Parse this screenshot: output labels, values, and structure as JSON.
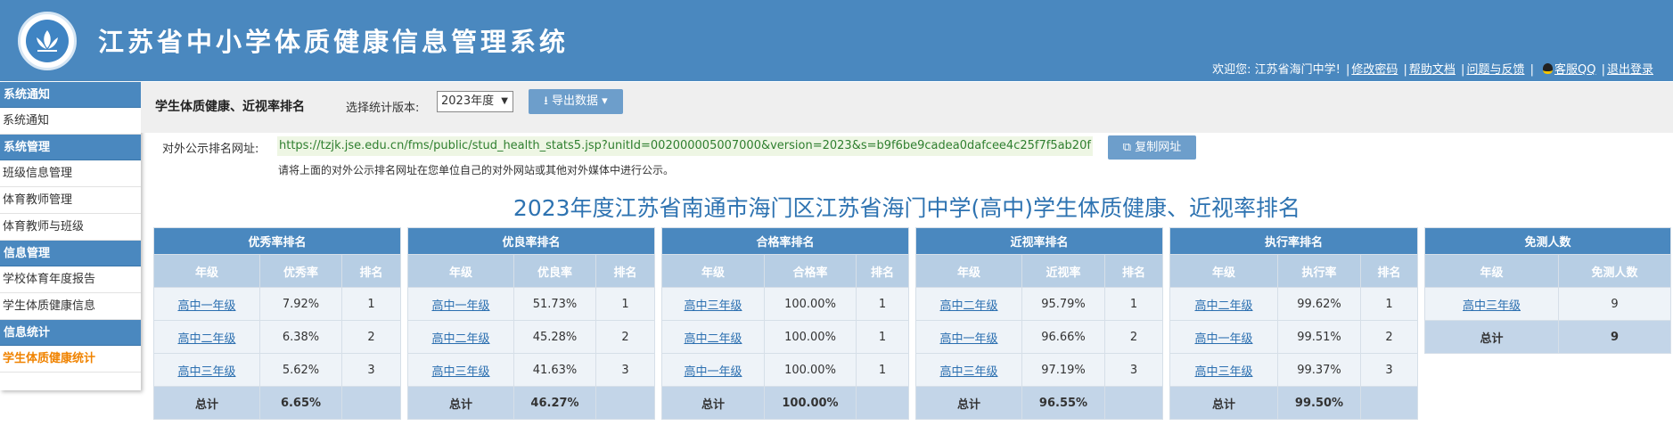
{
  "header": {
    "site_title": "江苏省中小学体质健康信息管理系统",
    "welcome": "欢迎您: 江苏省海门中学!",
    "links": [
      "修改密码",
      "帮助文档",
      "问题与反馈"
    ],
    "qq_label": "客服QQ",
    "logout": "退出登录"
  },
  "sidebar": {
    "groups": [
      {
        "title": "系统通知",
        "items": [
          "系统通知"
        ]
      },
      {
        "title": "系统管理",
        "items": [
          "班级信息管理",
          "体育教师管理",
          "体育教师与班级"
        ]
      },
      {
        "title": "信息管理",
        "items": [
          "学校体育年度报告",
          "学生体质健康信息"
        ]
      },
      {
        "title": "信息统计",
        "items": [
          "学生体质健康统计"
        ]
      }
    ],
    "active_item": "学生体质健康统计"
  },
  "toolbar": {
    "title": "学生体质健康、近视率排名",
    "version_label": "选择统计版本:",
    "version_value": "2023年度",
    "export_label": "导出数据"
  },
  "public_url": {
    "label": "对外公示排名网址:",
    "url": "https://tzjk.jse.edu.cn/fms/public/stud_health_stats5.jsp?unitId=002000005007000&version=2023&s=b9f6be9cadea0dafcee4c25f7f5ab20f",
    "copy_label": "复制网址",
    "note": "请将上面的对外公示排名网址在您单位自己的对外网站或其他对外媒体中进行公示。"
  },
  "report_title": "2023年度江苏省南通市海门区江苏省海门中学(高中)学生体质健康、近视率排名",
  "tables": [
    {
      "caption": "优秀率排名",
      "columns": [
        "年级",
        "优秀率",
        "排名"
      ],
      "rows": [
        [
          "高中一年级",
          "7.92%",
          "1"
        ],
        [
          "高中二年级",
          "6.38%",
          "2"
        ],
        [
          "高中三年级",
          "5.62%",
          "3"
        ]
      ],
      "total": [
        "总计",
        "6.65%",
        ""
      ]
    },
    {
      "caption": "优良率排名",
      "columns": [
        "年级",
        "优良率",
        "排名"
      ],
      "rows": [
        [
          "高中一年级",
          "51.73%",
          "1"
        ],
        [
          "高中二年级",
          "45.28%",
          "2"
        ],
        [
          "高中三年级",
          "41.63%",
          "3"
        ]
      ],
      "total": [
        "总计",
        "46.27%",
        ""
      ]
    },
    {
      "caption": "合格率排名",
      "columns": [
        "年级",
        "合格率",
        "排名"
      ],
      "rows": [
        [
          "高中三年级",
          "100.00%",
          "1"
        ],
        [
          "高中二年级",
          "100.00%",
          "1"
        ],
        [
          "高中一年级",
          "100.00%",
          "1"
        ]
      ],
      "total": [
        "总计",
        "100.00%",
        ""
      ]
    },
    {
      "caption": "近视率排名",
      "columns": [
        "年级",
        "近视率",
        "排名"
      ],
      "rows": [
        [
          "高中二年级",
          "95.79%",
          "1"
        ],
        [
          "高中一年级",
          "96.66%",
          "2"
        ],
        [
          "高中三年级",
          "97.19%",
          "3"
        ]
      ],
      "total": [
        "总计",
        "96.55%",
        ""
      ]
    },
    {
      "caption": "执行率排名",
      "columns": [
        "年级",
        "执行率",
        "排名"
      ],
      "rows": [
        [
          "高中二年级",
          "99.62%",
          "1"
        ],
        [
          "高中一年级",
          "99.51%",
          "2"
        ],
        [
          "高中三年级",
          "99.37%",
          "3"
        ]
      ],
      "total": [
        "总计",
        "99.50%",
        ""
      ]
    },
    {
      "caption": "免测人数",
      "columns": [
        "年级",
        "免测人数"
      ],
      "rows": [
        [
          "高中三年级",
          "9"
        ]
      ],
      "total": [
        "总计",
        "9"
      ]
    }
  ]
}
